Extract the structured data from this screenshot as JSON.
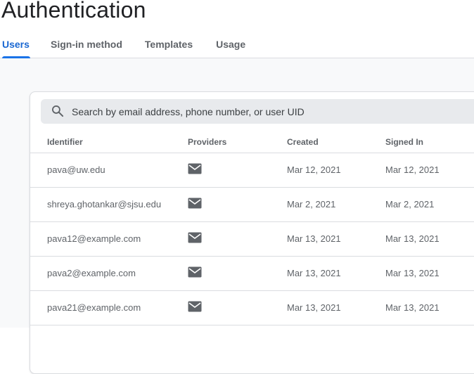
{
  "page": {
    "title": "Authentication"
  },
  "tabs": [
    {
      "label": "Users",
      "active": true
    },
    {
      "label": "Sign-in method",
      "active": false
    },
    {
      "label": "Templates",
      "active": false
    },
    {
      "label": "Usage",
      "active": false
    }
  ],
  "search": {
    "placeholder": "Search by email address, phone number, or user UID",
    "value": ""
  },
  "table": {
    "columns": [
      "Identifier",
      "Providers",
      "Created",
      "Signed In"
    ],
    "rows": [
      {
        "identifier": "pava@uw.edu",
        "provider_icon": "mail-icon",
        "created": "Mar 12, 2021",
        "signed_in": "Mar 12, 2021"
      },
      {
        "identifier": "shreya.ghotankar@sjsu.edu",
        "provider_icon": "mail-icon",
        "created": "Mar 2, 2021",
        "signed_in": "Mar 2, 2021"
      },
      {
        "identifier": "pava12@example.com",
        "provider_icon": "mail-icon",
        "created": "Mar 13, 2021",
        "signed_in": "Mar 13, 2021"
      },
      {
        "identifier": "pava2@example.com",
        "provider_icon": "mail-icon",
        "created": "Mar 13, 2021",
        "signed_in": "Mar 13, 2021"
      },
      {
        "identifier": "pava21@example.com",
        "provider_icon": "mail-icon",
        "created": "Mar 13, 2021",
        "signed_in": "Mar 13, 2021"
      }
    ]
  },
  "colors": {
    "accent": "#1a73e8",
    "active_tab_text": "#1967d2",
    "text_secondary": "#5f6368",
    "divider": "#dadce0",
    "search_bg": "#e8eaed",
    "page_bg": "#f8f9fa"
  }
}
